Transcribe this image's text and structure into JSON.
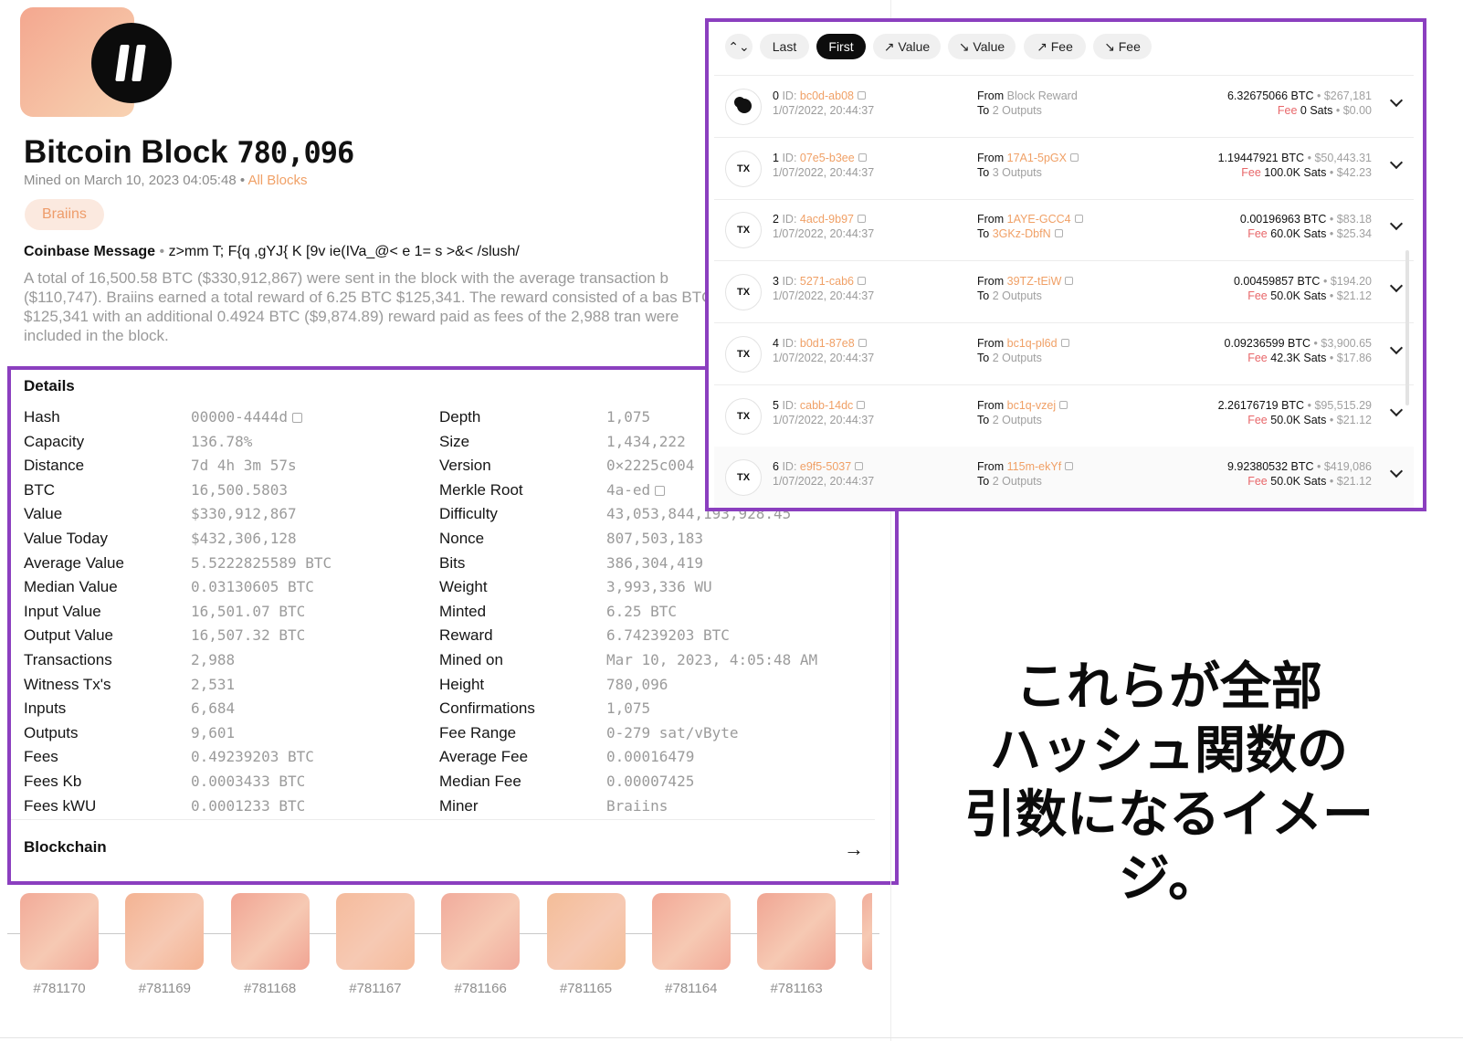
{
  "block": {
    "title_prefix": "Bitcoin Block",
    "number": "780,096",
    "mined_text": "Mined on March 10, 2023 04:05:48",
    "all_blocks_link": "All Blocks",
    "pool_tag": "Braiins",
    "coinbase_label": "Coinbase Message",
    "coinbase_text": "z>mm T; F{q ,gYJ{ K [9v ie(IVa_@<  e  1= s >&< /slush/",
    "summary": "A total of 16,500.58 BTC ($330,912,867) were sent in the block with the average transaction b ($110,747). Braiins earned a total reward of 6.25 BTC $125,341. The reward consisted of a bas BTC $125,341 with an additional 0.4924 BTC ($9,874.89) reward paid as fees of the 2,988 tran were included in the block."
  },
  "details": {
    "title": "Details",
    "left": [
      {
        "label": "Hash",
        "value": "00000-4444d",
        "copy": true
      },
      {
        "label": "Capacity",
        "value": "136.78%"
      },
      {
        "label": "Distance",
        "value": "7d 4h 3m 57s"
      },
      {
        "label": "BTC",
        "value": "16,500.5803"
      },
      {
        "label": "Value",
        "value": "$330,912,867"
      },
      {
        "label": "Value Today",
        "value": "$432,306,128"
      },
      {
        "label": "Average Value",
        "value": "5.5222825589 BTC"
      },
      {
        "label": "Median Value",
        "value": "0.03130605 BTC"
      },
      {
        "label": "Input Value",
        "value": "16,501.07 BTC"
      },
      {
        "label": "Output Value",
        "value": "16,507.32 BTC"
      },
      {
        "label": "Transactions",
        "value": "2,988"
      },
      {
        "label": "Witness Tx's",
        "value": "2,531"
      },
      {
        "label": "Inputs",
        "value": "6,684"
      },
      {
        "label": "Outputs",
        "value": "9,601"
      },
      {
        "label": "Fees",
        "value": "0.49239203 BTC"
      },
      {
        "label": "Fees Kb",
        "value": "0.0003433 BTC"
      },
      {
        "label": "Fees kWU",
        "value": "0.0001233 BTC"
      }
    ],
    "right": [
      {
        "label": "Depth",
        "value": "1,075"
      },
      {
        "label": "Size",
        "value": "1,434,222"
      },
      {
        "label": "Version",
        "value": "0×2225c004"
      },
      {
        "label": "Merkle Root",
        "value": "4a-ed",
        "copy": true
      },
      {
        "label": "Difficulty",
        "value": "43,053,844,193,928.45"
      },
      {
        "label": "Nonce",
        "value": "807,503,183"
      },
      {
        "label": "Bits",
        "value": "386,304,419"
      },
      {
        "label": "Weight",
        "value": "3,993,336 WU"
      },
      {
        "label": "Minted",
        "value": "6.25 BTC"
      },
      {
        "label": "Reward",
        "value": "6.74239203 BTC"
      },
      {
        "label": "Mined on",
        "value": "Mar 10, 2023, 4:05:48 AM"
      },
      {
        "label": "Height",
        "value": "780,096"
      },
      {
        "label": "Confirmations",
        "value": "1,075"
      },
      {
        "label": "Fee Range",
        "value": "0-279 sat/vByte"
      },
      {
        "label": "Average Fee",
        "value": "0.00016479"
      },
      {
        "label": "Median Fee",
        "value": "0.00007425"
      },
      {
        "label": "Miner",
        "value": "Braiins"
      }
    ],
    "blockchain_label": "Blockchain"
  },
  "tiles": {
    "labels": [
      "#781170",
      "#781169",
      "#781168",
      "#781167",
      "#781166",
      "#781165",
      "#781164",
      "#781163"
    ],
    "colors": [
      "#f2aa98",
      "#f4b393",
      "#f1a493",
      "#f5bb9c",
      "#f1ab9c",
      "#f4bd98",
      "#f2a896",
      "#f0a593",
      "#f1ad9b"
    ]
  },
  "sort_chips": [
    {
      "label": "⌃⌄",
      "icon": "sort-toggle-icon",
      "active": false
    },
    {
      "label": "Last",
      "active": false
    },
    {
      "label": "First",
      "active": true
    },
    {
      "label": "↗ Value",
      "active": false
    },
    {
      "label": "↘ Value",
      "active": false
    },
    {
      "label": "↗ Fee",
      "active": false
    },
    {
      "label": "↘ Fee",
      "active": false
    }
  ],
  "transactions": [
    {
      "index": "0",
      "id": "bc0d-ab08",
      "time": "1/07/2022, 20:44:37",
      "icon": "coinbase",
      "from_label": "From",
      "from": "Block Reward",
      "from_link": false,
      "to_label": "To",
      "to": "2 Outputs",
      "to_link": false,
      "btc": "6.32675066 BTC",
      "usd": "$267,181",
      "fee_label": "Fee",
      "fee": "0 Sats",
      "fee_usd": "$0.00"
    },
    {
      "index": "1",
      "id": "07e5-b3ee",
      "time": "1/07/2022, 20:44:37",
      "icon": "TX",
      "from_label": "From",
      "from": "17A1-5pGX",
      "from_link": true,
      "to_label": "To",
      "to": "3 Outputs",
      "to_link": false,
      "btc": "1.19447921 BTC",
      "usd": "$50,443.31",
      "fee_label": "Fee",
      "fee": "100.0K Sats",
      "fee_usd": "$42.23"
    },
    {
      "index": "2",
      "id": "4acd-9b97",
      "time": "1/07/2022, 20:44:37",
      "icon": "TX",
      "from_label": "From",
      "from": "1AYE-GCC4",
      "from_link": true,
      "to_label": "To",
      "to": "3GKz-DbfN",
      "to_link": true,
      "btc": "0.00196963 BTC",
      "usd": "$83.18",
      "fee_label": "Fee",
      "fee": "60.0K Sats",
      "fee_usd": "$25.34"
    },
    {
      "index": "3",
      "id": "5271-cab6",
      "time": "1/07/2022, 20:44:37",
      "icon": "TX",
      "from_label": "From",
      "from": "39TZ-tEiW",
      "from_link": true,
      "to_label": "To",
      "to": "2 Outputs",
      "to_link": false,
      "btc": "0.00459857 BTC",
      "usd": "$194.20",
      "fee_label": "Fee",
      "fee": "50.0K Sats",
      "fee_usd": "$21.12"
    },
    {
      "index": "4",
      "id": "b0d1-87e8",
      "time": "1/07/2022, 20:44:37",
      "icon": "TX",
      "from_label": "From",
      "from": "bc1q-pl6d",
      "from_link": true,
      "to_label": "To",
      "to": "2 Outputs",
      "to_link": false,
      "btc": "0.09236599 BTC",
      "usd": "$3,900.65",
      "fee_label": "Fee",
      "fee": "42.3K Sats",
      "fee_usd": "$17.86"
    },
    {
      "index": "5",
      "id": "cabb-14dc",
      "time": "1/07/2022, 20:44:37",
      "icon": "TX",
      "from_label": "From",
      "from": "bc1q-vzej",
      "from_link": true,
      "to_label": "To",
      "to": "2 Outputs",
      "to_link": false,
      "btc": "2.26176719 BTC",
      "usd": "$95,515.29",
      "fee_label": "Fee",
      "fee": "50.0K Sats",
      "fee_usd": "$21.12"
    },
    {
      "index": "6",
      "id": "e9f5-5037",
      "time": "1/07/2022, 20:44:37",
      "icon": "TX",
      "from_label": "From",
      "from": "115m-ekYf",
      "from_link": true,
      "to_label": "To",
      "to": "2 Outputs",
      "to_link": false,
      "btc": "9.92380532 BTC",
      "usd": "$419,086",
      "fee_label": "Fee",
      "fee": "50.0K Sats",
      "fee_usd": "$21.12"
    }
  ],
  "id_label": "ID:",
  "caption": {
    "line1": "これらが全部",
    "line2": "ハッシュ関数の",
    "line3": "引数になるイメージ。"
  },
  "colors": {
    "highlight_frame": "#8b3fbf",
    "link_orange": "#f0a066",
    "fee_red": "#e8676a",
    "pool_tag_bg": "#fbe9df"
  }
}
